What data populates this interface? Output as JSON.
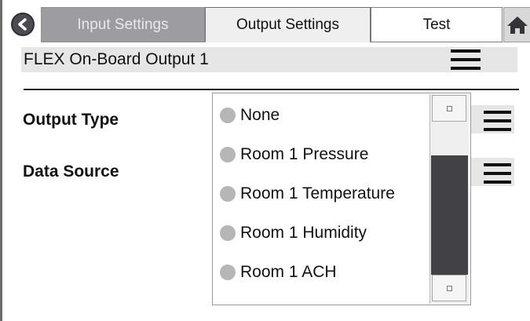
{
  "tabs": [
    {
      "label": "Input Settings",
      "state": "inactive"
    },
    {
      "label": "Output Settings",
      "state": "active"
    },
    {
      "label": "Test",
      "state": "normal"
    }
  ],
  "icons": {
    "back": "back-arrow-icon",
    "home": "home-icon",
    "menu": "hamburger-menu-icon"
  },
  "header": {
    "title": "FLEX On-Board Output 1"
  },
  "fields": {
    "output_type_label": "Output Type",
    "data_source_label": "Data Source"
  },
  "dropdown": {
    "options": [
      "None",
      "Room 1 Pressure",
      "Room 1 Temperature",
      "Room 1 Humidity",
      "Room 1 ACH"
    ]
  },
  "colors": {
    "inactive_tab": "#9c9ca1",
    "active_tab": "#efefef",
    "scroll_thumb": "#414146",
    "header_bg": "#e6e6e6",
    "radio": "#b6b6b6"
  }
}
